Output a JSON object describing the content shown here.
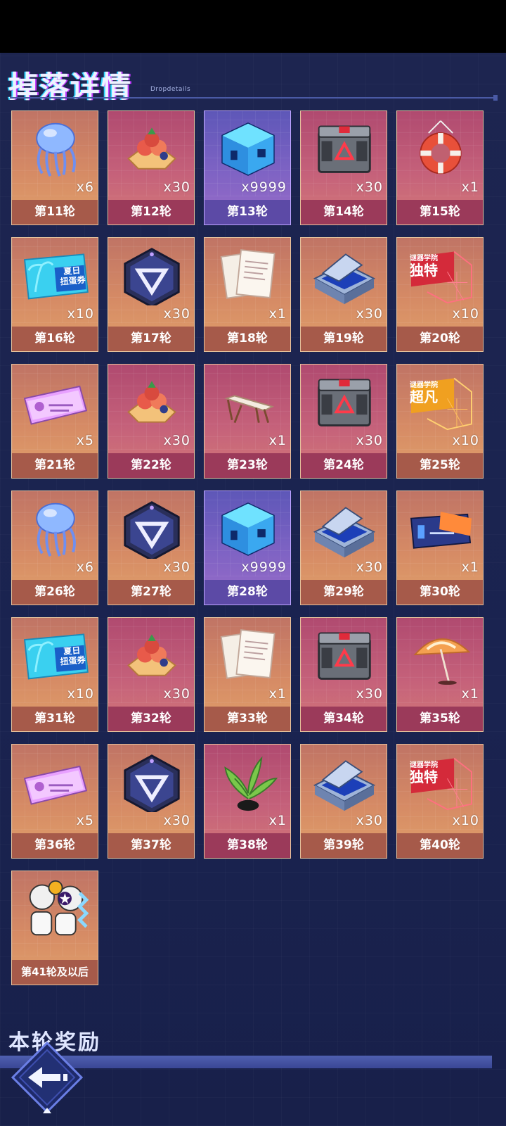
{
  "header": {
    "title": "掉落详情",
    "subtitle": "Dropdetails"
  },
  "rewards": [
    {
      "label": "第11轮",
      "count": "x6",
      "icon": "jellyfish-icon",
      "bg": "orange"
    },
    {
      "label": "第12轮",
      "count": "x30",
      "icon": "fruit-pile-icon",
      "bg": "red"
    },
    {
      "label": "第13轮",
      "count": "x9999",
      "icon": "blue-cube-icon",
      "bg": "purple"
    },
    {
      "label": "第14轮",
      "count": "x30",
      "icon": "tech-crate-icon",
      "bg": "red"
    },
    {
      "label": "第15轮",
      "count": "x1",
      "icon": "lifebuoy-icon",
      "bg": "red"
    },
    {
      "label": "第16轮",
      "count": "x10",
      "icon": "summer-gacha-ticket-icon",
      "ticket_text": [
        "夏日",
        "扭蛋券"
      ],
      "bg": "orange"
    },
    {
      "label": "第17轮",
      "count": "x30",
      "icon": "triangle-emblem-icon",
      "bg": "orange"
    },
    {
      "label": "第18轮",
      "count": "x1",
      "icon": "paper-documents-icon",
      "bg": "orange"
    },
    {
      "label": "第19轮",
      "count": "x30",
      "icon": "chip-case-icon",
      "bg": "orange"
    },
    {
      "label": "第20轮",
      "count": "x10",
      "icon": "unique-flag-icon",
      "flag_text": [
        "谜器学院",
        "独特"
      ],
      "bg": "orange"
    },
    {
      "label": "第21轮",
      "count": "x5",
      "icon": "pink-card-icon",
      "bg": "orange"
    },
    {
      "label": "第22轮",
      "count": "x30",
      "icon": "fruit-pile-icon",
      "bg": "red"
    },
    {
      "label": "第23轮",
      "count": "x1",
      "icon": "beach-chair-icon",
      "bg": "red"
    },
    {
      "label": "第24轮",
      "count": "x30",
      "icon": "tech-crate-icon",
      "bg": "red"
    },
    {
      "label": "第25轮",
      "count": "x10",
      "icon": "extraordinary-flag-icon",
      "flag_text": [
        "谜器学院",
        "超凡"
      ],
      "bg": "orange"
    },
    {
      "label": "第26轮",
      "count": "x6",
      "icon": "jellyfish-icon",
      "bg": "orange"
    },
    {
      "label": "第27轮",
      "count": "x30",
      "icon": "triangle-emblem-icon",
      "bg": "orange"
    },
    {
      "label": "第28轮",
      "count": "x9999",
      "icon": "blue-cube-icon",
      "bg": "purple"
    },
    {
      "label": "第29轮",
      "count": "x30",
      "icon": "chip-case-icon",
      "bg": "orange"
    },
    {
      "label": "第30轮",
      "count": "x1",
      "icon": "blue-card-icon",
      "bg": "orange"
    },
    {
      "label": "第31轮",
      "count": "x10",
      "icon": "summer-gacha-ticket-icon",
      "ticket_text": [
        "夏日",
        "扭蛋券"
      ],
      "bg": "orange"
    },
    {
      "label": "第32轮",
      "count": "x30",
      "icon": "fruit-pile-icon",
      "bg": "red"
    },
    {
      "label": "第33轮",
      "count": "x1",
      "icon": "paper-documents-icon",
      "bg": "orange"
    },
    {
      "label": "第34轮",
      "count": "x30",
      "icon": "tech-crate-icon",
      "bg": "red"
    },
    {
      "label": "第35轮",
      "count": "x1",
      "icon": "beach-umbrella-icon",
      "bg": "red"
    },
    {
      "label": "第36轮",
      "count": "x5",
      "icon": "pink-card-icon",
      "bg": "orange"
    },
    {
      "label": "第37轮",
      "count": "x30",
      "icon": "triangle-emblem-icon",
      "bg": "orange"
    },
    {
      "label": "第38轮",
      "count": "x1",
      "icon": "potted-plant-icon",
      "bg": "red"
    },
    {
      "label": "第39轮",
      "count": "x30",
      "icon": "chip-case-icon",
      "bg": "orange"
    },
    {
      "label": "第40轮",
      "count": "x10",
      "icon": "unique-flag-icon",
      "flag_text": [
        "谜器学院",
        "独特"
      ],
      "bg": "orange"
    },
    {
      "label": "第41轮及以后",
      "count": "",
      "icon": "robot-pile-icon",
      "bg": "orange"
    }
  ],
  "footer": {
    "title": "本轮奖励"
  },
  "colors": {
    "background": "#1c2450",
    "card_orange": "#d68b65",
    "card_red": "#c5617a",
    "card_purple": "#7f63c4",
    "accent_cyan": "#2fd6ff",
    "accent_magenta": "#c23bff"
  }
}
